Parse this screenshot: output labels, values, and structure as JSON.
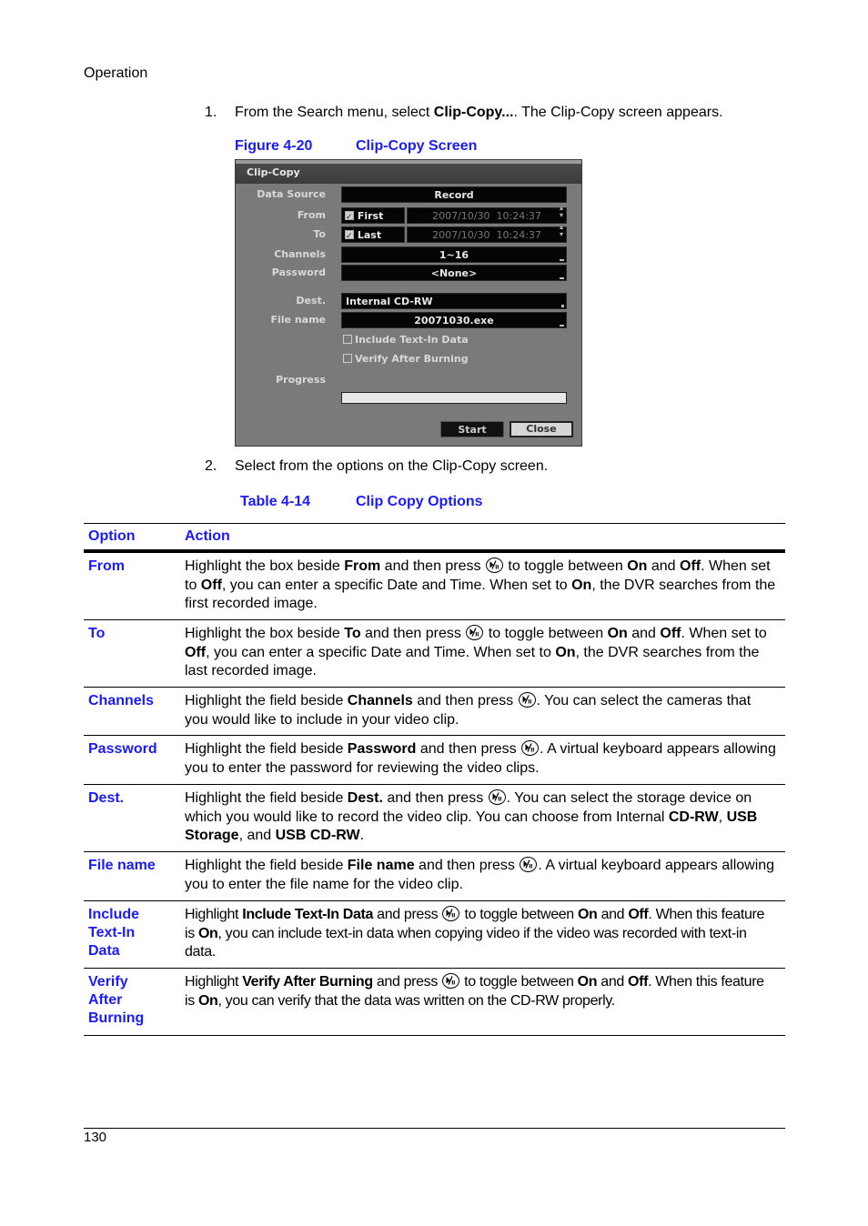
{
  "page": {
    "section_header": "Operation",
    "page_number": "130"
  },
  "steps": [
    {
      "number": "1.",
      "text_before": "From the Search menu, select ",
      "bold": "Clip-Copy...",
      "text_after": ". The Clip-Copy screen appears."
    },
    {
      "number": "2.",
      "text": "Select from the options on the Clip-Copy screen."
    }
  ],
  "figure": {
    "label": "Figure 4-20",
    "title": "Clip-Copy Screen"
  },
  "dvr_screen": {
    "window_title": "Clip-Copy",
    "fields": {
      "data_source": {
        "label": "Data Source",
        "value": "Record"
      },
      "from": {
        "label": "From",
        "checkbox_label": "First",
        "checked": true,
        "datetime": "2007/10/30  10:24:37"
      },
      "to": {
        "label": "To",
        "checkbox_label": "Last",
        "checked": true,
        "datetime": "2007/10/30  10:24:37"
      },
      "channels": {
        "label": "Channels",
        "value": "1~16"
      },
      "password": {
        "label": "Password",
        "value": "<None>"
      },
      "dest": {
        "label": "Dest.",
        "value": "Internal CD-RW"
      },
      "file_name": {
        "label": "File name",
        "value": "20071030.exe"
      }
    },
    "options": [
      {
        "label": "Include Text-In Data",
        "checked": false
      },
      {
        "label": "Verify After Burning",
        "checked": false
      }
    ],
    "progress": {
      "label": "Progress",
      "value_percent": 0
    },
    "buttons": {
      "start": "Start",
      "close": "Close"
    }
  },
  "table": {
    "label": "Table 4-14",
    "title": "Clip Copy Options",
    "headers": [
      "Option",
      "Action"
    ],
    "rows": [
      {
        "option": "From",
        "action": [
          {
            "t": "Highlight the box beside "
          },
          {
            "b": "From"
          },
          {
            "t": " and then press "
          },
          {
            "icon": "play-pause-button-icon"
          },
          {
            "t": " to toggle between "
          },
          {
            "b": "On"
          },
          {
            "t": " and "
          },
          {
            "b": "Off"
          },
          {
            "t": ". When set to "
          },
          {
            "b": "Off"
          },
          {
            "t": ", you can enter a specific Date and Time. When set to "
          },
          {
            "b": "On"
          },
          {
            "t": ", the DVR searches from the first recorded image."
          }
        ]
      },
      {
        "option": "To",
        "action": [
          {
            "t": "Highlight the box beside "
          },
          {
            "b": "To"
          },
          {
            "t": " and then press "
          },
          {
            "icon": "play-pause-button-icon"
          },
          {
            "t": " to toggle between "
          },
          {
            "b": "On"
          },
          {
            "t": " and "
          },
          {
            "b": "Off"
          },
          {
            "t": ". When set to "
          },
          {
            "b": "Off"
          },
          {
            "t": ", you can enter a specific Date and Time. When set to "
          },
          {
            "b": "On"
          },
          {
            "t": ", the DVR searches from the last recorded image."
          }
        ]
      },
      {
        "option": "Channels",
        "action": [
          {
            "t": "Highlight the field beside "
          },
          {
            "b": "Channels"
          },
          {
            "t": " and then press "
          },
          {
            "icon": "play-pause-button-icon"
          },
          {
            "t": ". You can select the cameras that you would like to include in your video clip."
          }
        ]
      },
      {
        "option": "Password",
        "action": [
          {
            "t": "Highlight the field beside "
          },
          {
            "b": "Password"
          },
          {
            "t": " and then press "
          },
          {
            "icon": "play-pause-button-icon"
          },
          {
            "t": ". A virtual keyboard appears allowing you to enter the password for reviewing the video clips."
          }
        ]
      },
      {
        "option": "Dest.",
        "action": [
          {
            "t": "Highlight the field beside "
          },
          {
            "b": "Dest."
          },
          {
            "t": " and then press "
          },
          {
            "icon": "play-pause-button-icon"
          },
          {
            "t": ". You can select the storage device on which you would like to record the video clip. You can choose from Internal "
          },
          {
            "b": "CD-RW"
          },
          {
            "t": ", "
          },
          {
            "b": "USB Storage"
          },
          {
            "t": ", and "
          },
          {
            "b": "USB CD-RW"
          },
          {
            "t": "."
          }
        ]
      },
      {
        "option": "File name",
        "action": [
          {
            "t": "Highlight the field beside "
          },
          {
            "b": "File name"
          },
          {
            "t": " and then press "
          },
          {
            "icon": "play-pause-button-icon"
          },
          {
            "t": ". A virtual keyboard appears allowing you to enter the file name for the video clip."
          }
        ]
      },
      {
        "option": "Include Text-In Data",
        "action": [
          {
            "t": "Highlight "
          },
          {
            "b": "Include Text-In Data"
          },
          {
            "t": " and press "
          },
          {
            "icon": "play-pause-button-icon"
          },
          {
            "t": " to toggle between "
          },
          {
            "b": "On"
          },
          {
            "t": " and "
          },
          {
            "b": "Off"
          },
          {
            "t": ". When this feature is "
          },
          {
            "b": "On"
          },
          {
            "t": ", you can include text-in data when copying video if the video was recorded with text-in data."
          }
        ]
      },
      {
        "option": "Verify After Burning",
        "action": [
          {
            "t": "Highlight "
          },
          {
            "b": "Verify After Burning"
          },
          {
            "t": " and press "
          },
          {
            "icon": "play-pause-button-icon"
          },
          {
            "t": " to toggle between "
          },
          {
            "b": "On"
          },
          {
            "t": " and "
          },
          {
            "b": "Off"
          },
          {
            "t": ". When this feature is "
          },
          {
            "b": "On"
          },
          {
            "t": ", you can verify that the data was written on the CD-RW properly."
          }
        ]
      }
    ]
  }
}
